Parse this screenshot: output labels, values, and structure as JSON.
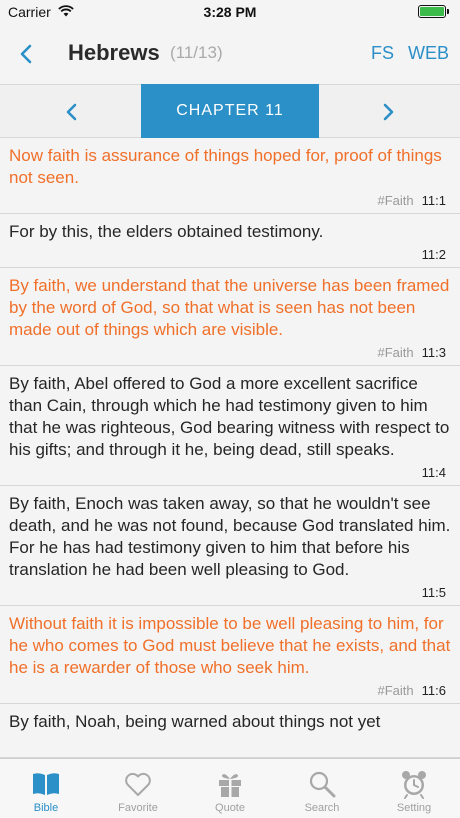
{
  "status": {
    "carrier": "Carrier",
    "time": "3:28 PM"
  },
  "nav": {
    "title": "Hebrews",
    "count": "(11/13)",
    "fs": "FS",
    "web": "WEB"
  },
  "chapter": {
    "label": "CHAPTER 11"
  },
  "verses": [
    {
      "text": "Now faith is assurance of things hoped for, proof of things not seen.",
      "tag": "#Faith",
      "ref": "11:1",
      "highlight": true
    },
    {
      "text": "For by this, the elders obtained testimony.",
      "tag": "",
      "ref": "11:2",
      "highlight": false
    },
    {
      "text": "By faith, we understand that the universe has been framed by the word of God, so that what is seen has not been made out of things which are visible.",
      "tag": "#Faith",
      "ref": "11:3",
      "highlight": true
    },
    {
      "text": "By faith, Abel offered to God a more excellent sacrifice than Cain, through which he had testimony given to him that he was righteous, God bearing witness with respect to his gifts; and through it he, being dead, still speaks.",
      "tag": "",
      "ref": "11:4",
      "highlight": false
    },
    {
      "text": "By faith, Enoch was taken away, so that he wouldn't see death, and he was not found, because God translated him. For he has had testimony given to him that before his translation he had been well pleasing to God.",
      "tag": "",
      "ref": "11:5",
      "highlight": false
    },
    {
      "text": "Without faith it is impossible to be well pleasing to him, for he who comes to God must believe that he exists, and that he is a rewarder of those who seek him.",
      "tag": "#Faith",
      "ref": "11:6",
      "highlight": true
    },
    {
      "text": "By faith, Noah, being warned about things not yet",
      "tag": "",
      "ref": "",
      "highlight": false
    }
  ],
  "tabs": [
    {
      "label": "Bible",
      "icon": "book-icon",
      "active": true
    },
    {
      "label": "Favorite",
      "icon": "heart-icon",
      "active": false
    },
    {
      "label": "Quote",
      "icon": "gift-icon",
      "active": false
    },
    {
      "label": "Search",
      "icon": "search-icon",
      "active": false
    },
    {
      "label": "Setting",
      "icon": "alarm-clock-icon",
      "active": false
    }
  ],
  "colors": {
    "accent": "#2b8fc8",
    "highlight": "#f0702a",
    "battery": "#3dbb4a"
  }
}
